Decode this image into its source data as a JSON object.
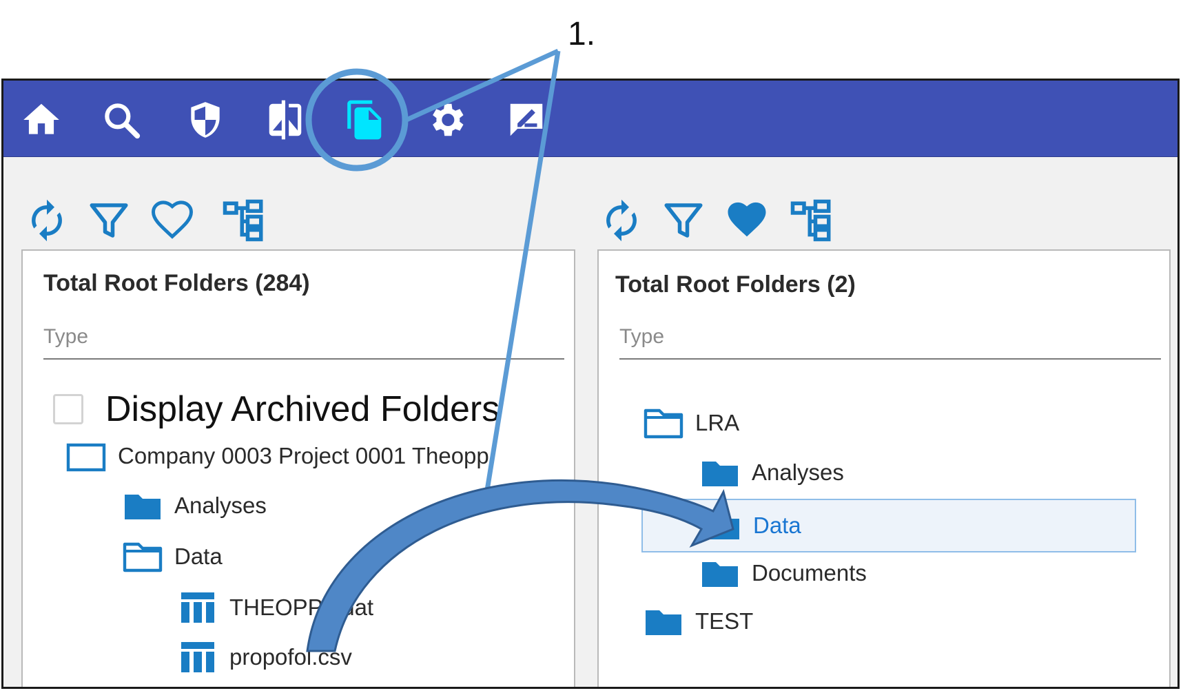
{
  "annotation": {
    "label": "1."
  },
  "colors": {
    "nav_bg": "#3f51b5",
    "active_nav": "#00e5ff",
    "accent": "#1a7dc4",
    "callout": "#5b9bd5",
    "arrow_fill": "#4f87c7"
  },
  "nav": {
    "items": [
      {
        "icon": "home-icon"
      },
      {
        "icon": "search-icon"
      },
      {
        "icon": "shield-icon"
      },
      {
        "icon": "compare-icon"
      },
      {
        "icon": "files-icon",
        "active": true
      },
      {
        "icon": "gear-icon"
      },
      {
        "icon": "edit-icon"
      }
    ]
  },
  "left_panel": {
    "toolbar": [
      "refresh-icon",
      "filter-icon",
      "favorite-outline-icon",
      "tree-view-icon"
    ],
    "title": "Total Root Folders (284)",
    "type_placeholder": "Type",
    "archived_label": "Display Archived Folders",
    "tree": {
      "root": "Company 0003 Project 0001 Theopp",
      "analyses": "Analyses",
      "data": "Data",
      "file1": "THEOPP2.dat",
      "file2": "propofol.csv"
    }
  },
  "right_panel": {
    "toolbar": [
      "refresh-icon",
      "filter-icon",
      "favorite-filled-icon",
      "tree-view-icon"
    ],
    "title": "Total Root Folders (2)",
    "type_placeholder": "Type",
    "tree": {
      "lra": "LRA",
      "analyses": "Analyses",
      "data": "Data",
      "documents": "Documents",
      "test": "TEST"
    }
  }
}
